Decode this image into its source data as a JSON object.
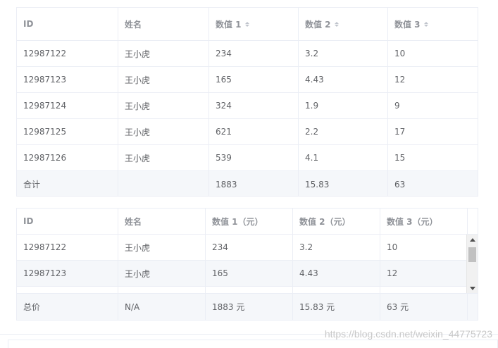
{
  "table1": {
    "headers": [
      "ID",
      "姓名",
      "数值 1",
      "数值 2",
      "数值 3"
    ],
    "rows": [
      [
        "12987122",
        "王小虎",
        "234",
        "3.2",
        "10"
      ],
      [
        "12987123",
        "王小虎",
        "165",
        "4.43",
        "12"
      ],
      [
        "12987124",
        "王小虎",
        "324",
        "1.9",
        "9"
      ],
      [
        "12987125",
        "王小虎",
        "621",
        "2.2",
        "17"
      ],
      [
        "12987126",
        "王小虎",
        "539",
        "4.1",
        "15"
      ]
    ],
    "summary": [
      "合计",
      "",
      "1883",
      "15.83",
      "63"
    ]
  },
  "table2": {
    "headers": [
      "ID",
      "姓名",
      "数值 1（元）",
      "数值 2（元）",
      "数值 3（元）"
    ],
    "rows": [
      [
        "12987122",
        "王小虎",
        "234",
        "3.2",
        "10"
      ],
      [
        "12987123",
        "王小虎",
        "165",
        "4.43",
        "12"
      ]
    ],
    "summary": [
      "总价",
      "N/A",
      "1883 元",
      "15.83 元",
      "63 元"
    ]
  },
  "watermark": "https://blog.csdn.net/weixin_44775723"
}
